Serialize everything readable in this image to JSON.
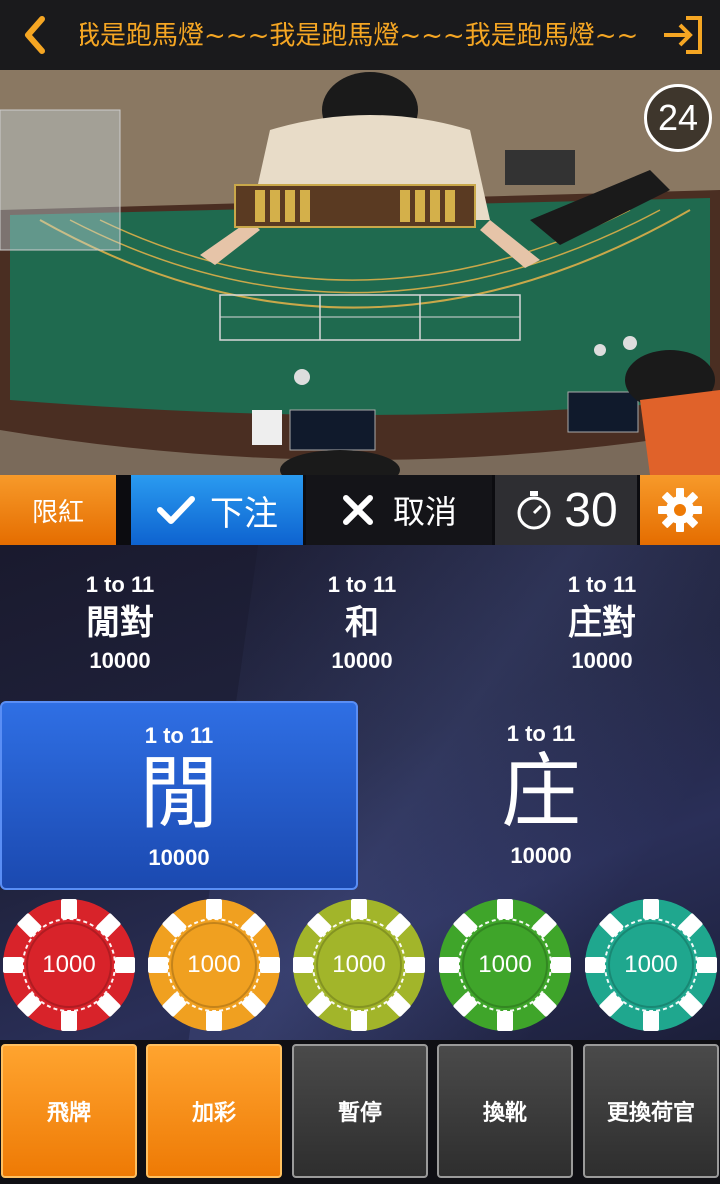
{
  "topbar": {
    "marquee_text": "我是跑馬燈~~~我是跑馬燈~~~我是跑馬燈~~",
    "back_icon": "chevron-left-icon",
    "exit_icon": "exit-icon"
  },
  "video": {
    "round_number": "24"
  },
  "actions": {
    "limit_label": "限紅",
    "bet_label": "下注",
    "cancel_label": "取消",
    "timer_value": "30"
  },
  "bets": {
    "player_pair": {
      "ratio": "1 to 11",
      "name": "閒對",
      "amount": "10000"
    },
    "tie": {
      "ratio": "1 to 11",
      "name": "和",
      "amount": "10000"
    },
    "banker_pair": {
      "ratio": "1 to 11",
      "name": "庄對",
      "amount": "10000"
    },
    "player": {
      "ratio": "1 to 11",
      "name": "閒",
      "amount": "10000"
    },
    "banker": {
      "ratio": "1 to 11",
      "name": "庄",
      "amount": "10000"
    }
  },
  "chips": [
    {
      "value": "1000",
      "color": "#d8232a"
    },
    {
      "value": "1000",
      "color": "#f0a020"
    },
    {
      "value": "1000",
      "color": "#a2b52a"
    },
    {
      "value": "1000",
      "color": "#3fa52a"
    },
    {
      "value": "1000",
      "color": "#1fa78e"
    }
  ],
  "bottom_buttons": [
    {
      "label": "飛牌",
      "style": "orange"
    },
    {
      "label": "加彩",
      "style": "orange"
    },
    {
      "label": "暫停",
      "style": "gray"
    },
    {
      "label": "換靴",
      "style": "gray"
    },
    {
      "label": "更換荷官",
      "style": "gray"
    }
  ],
  "colors": {
    "accent_orange": "#f5a623",
    "bet_blue": "#1e6fe0",
    "player_blue": "#2557c8"
  }
}
